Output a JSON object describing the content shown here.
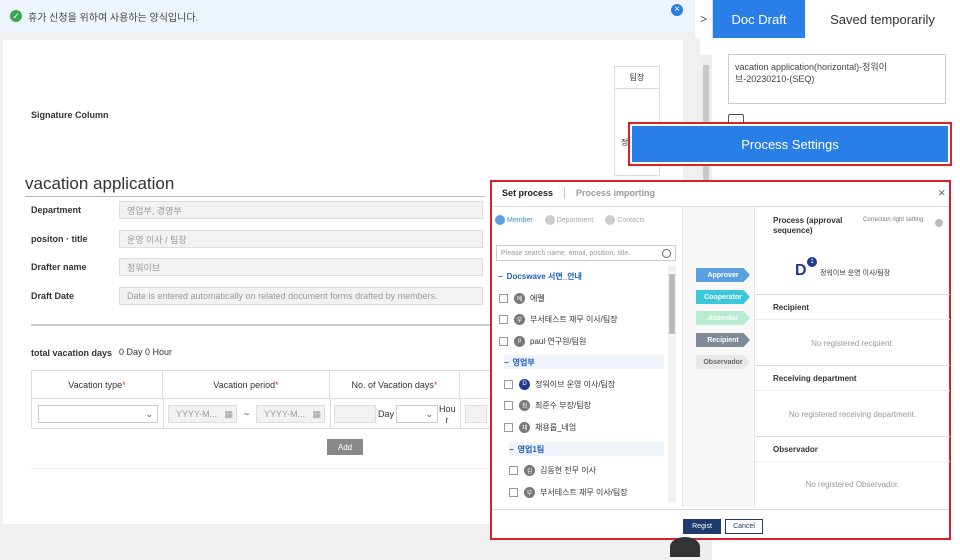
{
  "notice": {
    "text": "휴가 신청을 위하여 사용하는 양식입니다."
  },
  "form": {
    "signature_label": "Signature Column",
    "approver_role": "팀장",
    "approver_role2": "정",
    "title": "vacation application",
    "fields": [
      {
        "label": "Department",
        "value": "영업부, 경영부"
      },
      {
        "label": "positon · title",
        "value": "운영 이사 / 팀장"
      },
      {
        "label": "Drafter name",
        "value": "정워이브"
      },
      {
        "label": "Draft Date",
        "value": "Date is entered automatically on related document forms drafted by members."
      }
    ],
    "total_label": "total vacation days",
    "total_value": "0 Day 0 Hour",
    "table_headers": [
      "Vacation type",
      "Vacation period",
      "No. of Vacation days"
    ],
    "date_placeholder": "YYYY-M...",
    "tilde": "~",
    "day_label": "Day",
    "hour_label": "Hou r",
    "add_button": "Add"
  },
  "right_panel": {
    "arrow": ">",
    "tabs": [
      "Doc Draft",
      "Saved temporarily"
    ],
    "doc_title": "vacation application(horizontal)-정워이브-20230210-(SEQ)",
    "process_button": "Process Settings"
  },
  "modal": {
    "tabs": [
      "Set process",
      "Process importing"
    ],
    "close": "×",
    "subtabs": [
      "Member",
      "Department",
      "Contacts"
    ],
    "search_placeholder": "Please search name, email, position, title.",
    "tree": [
      {
        "type": "group",
        "text": "Docswave 서면_안내"
      },
      {
        "type": "member",
        "avatar": "에",
        "text": "에펠"
      },
      {
        "type": "member",
        "avatar": "부",
        "text": "부서테스트 재무 이사/팀장"
      },
      {
        "type": "member",
        "avatar": "p",
        "text": "paul 연구원/팀원"
      },
      {
        "type": "group",
        "text": "영업부"
      },
      {
        "type": "member",
        "avatar": "D",
        "text": "정워이브 운영 이사/팀장"
      },
      {
        "type": "member",
        "avatar": "최",
        "text": "최준수 부장/팀장"
      },
      {
        "type": "member",
        "avatar": "채",
        "text": "채용룹_네엄"
      },
      {
        "type": "group",
        "text": "영업1팀"
      },
      {
        "type": "member",
        "avatar": "김",
        "text": "김동현 전무 이사"
      },
      {
        "type": "member",
        "avatar": "부",
        "text": "부서테스트 재무 이사/팀장"
      }
    ],
    "roles": [
      {
        "label": "Approver",
        "color": "#5aa0e0"
      },
      {
        "label": "Cooperator",
        "color": "#3cc8d8"
      },
      {
        "label": "Assentor",
        "color": "#b8ecd0"
      },
      {
        "label": "Recipient",
        "color": "#7f8a96"
      },
      {
        "label": "Observador",
        "color": "#e8e8e8"
      }
    ],
    "process_title": "Process (approval sequence)",
    "correction_label": "Correction right setting",
    "approver_name": "정워이브 운영 이사/팀장",
    "approver_count": "1",
    "sections": [
      {
        "title": "Recipient",
        "empty": "No registered recipient."
      },
      {
        "title": "Receiving department",
        "empty": "No registered receiving department."
      },
      {
        "title": "Observador",
        "empty": "No registered Observador."
      }
    ],
    "regist_button": "Regist",
    "cancel_button": "Cancel"
  }
}
